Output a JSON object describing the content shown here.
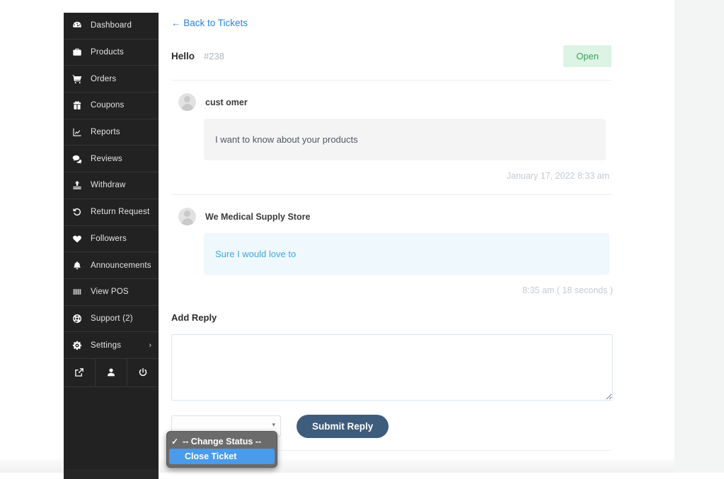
{
  "sidebar": {
    "items": [
      {
        "label": "Dashboard",
        "icon": "gauge-icon"
      },
      {
        "label": "Products",
        "icon": "briefcase-icon"
      },
      {
        "label": "Orders",
        "icon": "cart-icon"
      },
      {
        "label": "Coupons",
        "icon": "gift-icon"
      },
      {
        "label": "Reports",
        "icon": "chart-icon"
      },
      {
        "label": "Reviews",
        "icon": "comment-icon"
      },
      {
        "label": "Withdraw",
        "icon": "upload-icon"
      },
      {
        "label": "Return Request",
        "icon": "undo-icon"
      },
      {
        "label": "Followers",
        "icon": "heart-icon"
      },
      {
        "label": "Announcements",
        "icon": "bell-icon"
      },
      {
        "label": "View POS",
        "icon": "barcode-icon"
      },
      {
        "label": "Support (2)",
        "icon": "lifering-icon"
      },
      {
        "label": "Settings",
        "icon": "gear-icon",
        "chevron": "›"
      }
    ],
    "footer_icons": [
      {
        "name": "external-link-icon"
      },
      {
        "name": "user-icon"
      },
      {
        "name": "power-icon"
      }
    ]
  },
  "main": {
    "back_link": "← Back to Tickets",
    "ticket_title": "Hello",
    "ticket_number": "#238",
    "status_badge": "Open",
    "messages": [
      {
        "author": "cust omer",
        "body": "I want to know about your products",
        "time": "January 17, 2022 8:33 am",
        "kind": "customer"
      },
      {
        "author": "We Medical Supply Store",
        "body": "Sure I would love to",
        "time": "8:35 am ( 18 seconds )",
        "kind": "vendor"
      }
    ],
    "add_reply_label": "Add Reply",
    "reply_value": "",
    "reply_placeholder": "",
    "status_select_value": "-- Change Status --",
    "status_select_caret": "▾",
    "submit_label": "Submit Reply"
  },
  "select_popup": {
    "items": [
      {
        "label": "-- Change Status --",
        "checked": "✓",
        "selected": false
      },
      {
        "label": "Close Ticket",
        "checked": "",
        "selected": true
      }
    ]
  },
  "colors": {
    "sidebar_bg": "#222222",
    "accent_link": "#2f7fd8",
    "status_open_bg": "#ddf3e4",
    "status_open_fg": "#35a35f",
    "vendor_bubble_bg": "#eff8fc",
    "vendor_bubble_fg": "#3ea8e0",
    "submit_bg": "#3e5c7b",
    "popup_highlight": "#4a9bea"
  }
}
